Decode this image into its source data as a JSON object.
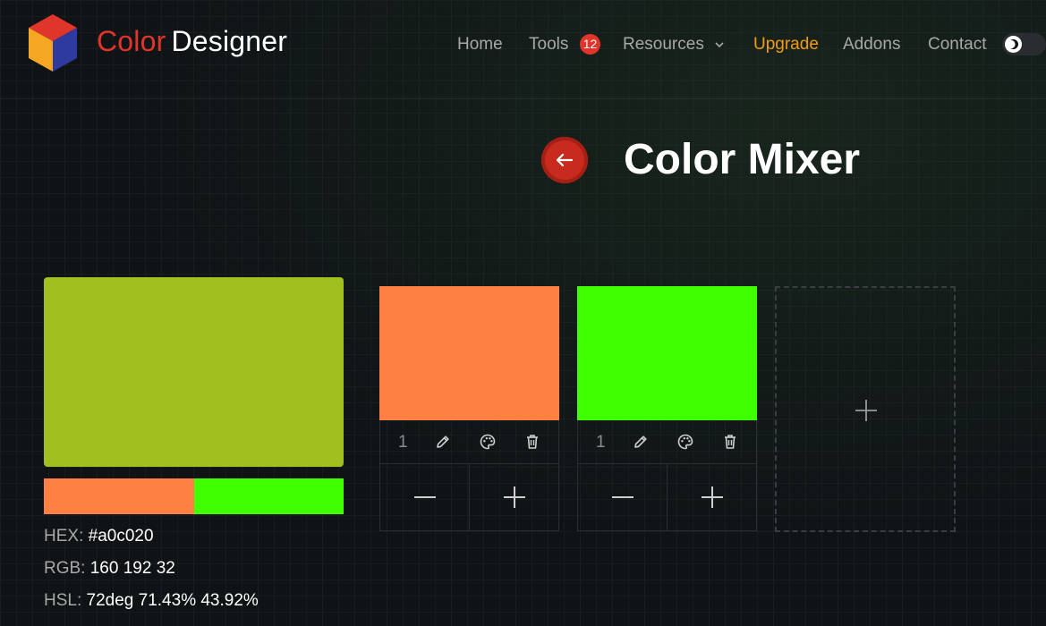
{
  "brand": {
    "part1": "Color",
    "part2": "Designer"
  },
  "nav": {
    "home": "Home",
    "tools": "Tools",
    "tools_badge": "12",
    "resources": "Resources",
    "upgrade": "Upgrade",
    "addons": "Addons",
    "contact": "Contact"
  },
  "colors": {
    "brand_red": "#e0352b",
    "upgrade_orange": "#f39c12"
  },
  "title": "Color Mixer",
  "result": {
    "color": "#a0c020",
    "hex_label": "HEX:",
    "hex_value": "#a0c020",
    "rgb_label": "RGB:",
    "rgb_value": "160 192 32",
    "hsl_label": "HSL:",
    "hsl_value": "72deg 71.43% 43.92%"
  },
  "ratio": [
    {
      "color": "#ff8040",
      "weight": 1
    },
    {
      "color": "#40ff00",
      "weight": 1
    }
  ],
  "mix_colors": [
    {
      "color": "#ff8040",
      "weight": "1"
    },
    {
      "color": "#40ff00",
      "weight": "1"
    }
  ],
  "icons": {
    "edit": "pencil-icon",
    "picker": "palette-icon",
    "delete": "trash-icon",
    "decrease": "minus-icon",
    "increase": "plus-icon",
    "add": "plus-icon",
    "back": "arrow-left-icon",
    "theme": "moon-icon"
  }
}
